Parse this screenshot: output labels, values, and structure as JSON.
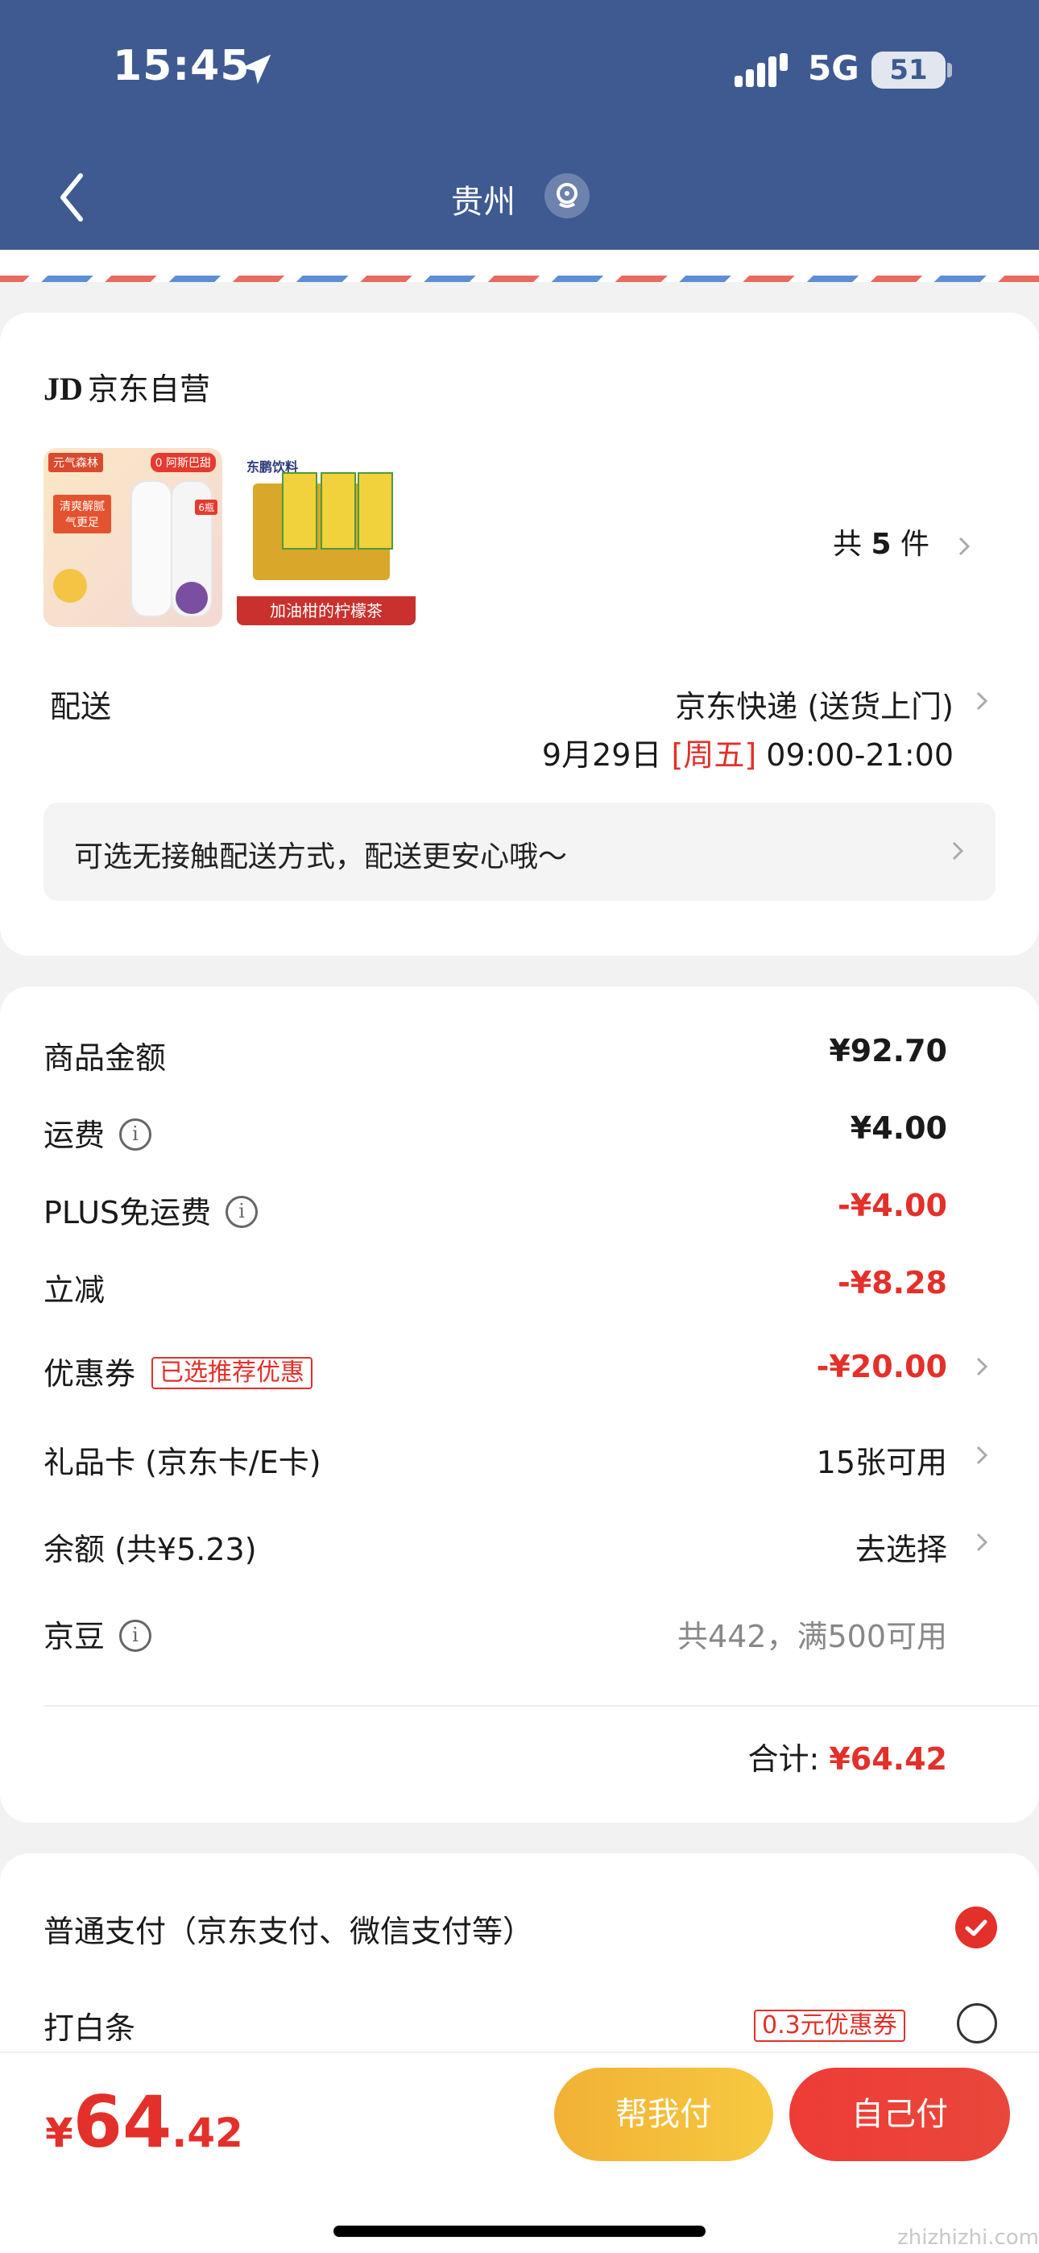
{
  "status_bar": {
    "time": "15:45",
    "network": "5G",
    "battery": "51"
  },
  "nav": {
    "title": "贵州"
  },
  "shop": {
    "name_prefix": "JD",
    "name": "京东自营",
    "item_count_prefix": "共",
    "item_count": "5",
    "item_count_suffix": "件",
    "product1": {
      "brand": "元气森林",
      "badge": "0 阿斯巴甜",
      "blurb": "清爽解腻 气更足",
      "pack": "6瓶"
    },
    "product2": {
      "brand": "东鹏饮料",
      "caption": "加油柑的柠檬茶"
    }
  },
  "delivery": {
    "label": "配送",
    "method": "京东快递 (送货上门)",
    "date": "9月29日",
    "weekday": "[周五]",
    "time": "09:00-21:00",
    "hint": "可选无接触配送方式，配送更安心哦～"
  },
  "pricing": {
    "rows": [
      {
        "label": "商品金额",
        "value": "¥92.70"
      },
      {
        "label": "运费",
        "value": "¥4.00"
      },
      {
        "label": "PLUS免运费",
        "value": "-¥4.00"
      },
      {
        "label": "立减",
        "value": "-¥8.28"
      },
      {
        "label": "优惠券",
        "tag": "已选推荐优惠",
        "value": "-¥20.00"
      },
      {
        "label": "礼品卡 (京东卡/E卡)",
        "value": "15张可用"
      },
      {
        "label": "余额 (共¥5.23)",
        "value": "去选择"
      },
      {
        "label": "京豆",
        "value": "共442，满500可用"
      }
    ],
    "total_label": "合计:",
    "total_value": "¥64.42"
  },
  "payment": {
    "normal": "普通支付（京东支付、微信支付等）",
    "baitiao": "打白条",
    "baitiao_tag": "0.3元优惠券"
  },
  "bottom": {
    "currency": "¥",
    "price_int": "64",
    "price_dec": ".42",
    "help_pay": "帮我付",
    "self_pay": "自己付"
  },
  "watermark": "zhizhizhi.com",
  "colors": {
    "header": "#3e5a91",
    "accent_red": "#e3302a",
    "help_btn": "#f2b135"
  }
}
